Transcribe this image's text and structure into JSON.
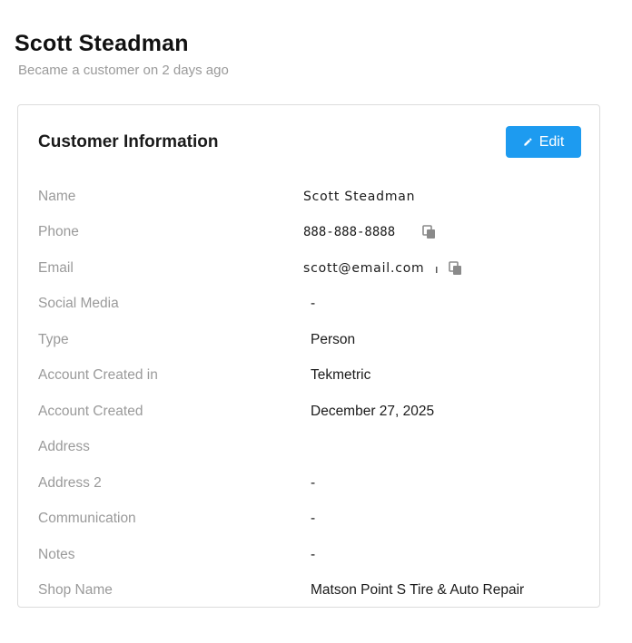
{
  "header": {
    "customer_name": "Scott Steadman",
    "subtitle": "Became a customer on 2 days ago"
  },
  "card": {
    "title": "Customer Information",
    "edit_label": "Edit",
    "rows": [
      {
        "label": "Name",
        "value": "Scott Steadman"
      },
      {
        "label": "Phone",
        "value": "888-888-8888"
      },
      {
        "label": "Email",
        "value": "scott@email.com",
        "trailing": "ı"
      },
      {
        "label": "Social Media",
        "value": "-"
      },
      {
        "label": "Type",
        "value": "Person"
      },
      {
        "label": "Account Created in",
        "value": "Tekmetric"
      },
      {
        "label": "Account Created",
        "value": "December 27, 2025"
      },
      {
        "label": "Address",
        "value": ""
      },
      {
        "label": "Address 2",
        "value": "-"
      },
      {
        "label": "Communication",
        "value": "-"
      },
      {
        "label": "Notes",
        "value": "-"
      },
      {
        "label": "Shop Name",
        "value": "Matson Point S Tire & Auto Repair"
      }
    ]
  },
  "icons": {
    "edit": "pencil-icon",
    "copy": "copy-icon"
  },
  "colors": {
    "accent": "#1d9bf0",
    "label": "#9a9a9a",
    "value": "#1a1a1a",
    "icon": "#8a8a8a"
  }
}
